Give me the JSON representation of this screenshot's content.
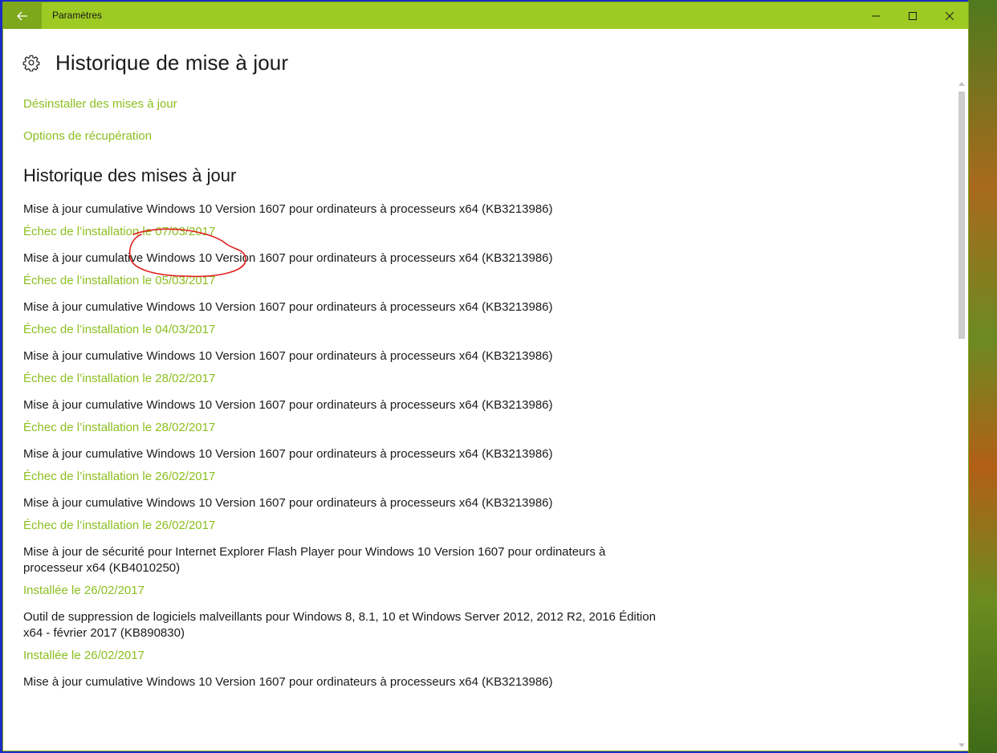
{
  "window": {
    "title": "Paramètres",
    "accent_color": "#9dcb23",
    "back_button_color": "#7ea81b",
    "link_color": "#8cbf20"
  },
  "header": {
    "icon": "gear-icon",
    "title": "Historique de mise à jour"
  },
  "links": {
    "uninstall": "Désinstaller des mises à jour",
    "recovery": "Options de récupération"
  },
  "history": {
    "section_title": "Historique des mises à jour",
    "items": [
      {
        "name": "Mise à jour cumulative Windows 10 Version 1607 pour ordinateurs à processeurs x64 (KB3213986)",
        "status": "Échec de l’installation le 07/03/2017"
      },
      {
        "name": "Mise à jour cumulative Windows 10 Version 1607 pour ordinateurs à processeurs x64 (KB3213986)",
        "status": "Échec de l’installation le 05/03/2017"
      },
      {
        "name": "Mise à jour cumulative Windows 10 Version 1607 pour ordinateurs à processeurs x64 (KB3213986)",
        "status": "Échec de l’installation le 04/03/2017"
      },
      {
        "name": "Mise à jour cumulative Windows 10 Version 1607 pour ordinateurs à processeurs x64 (KB3213986)",
        "status": "Échec de l’installation le 28/02/2017"
      },
      {
        "name": "Mise à jour cumulative Windows 10 Version 1607 pour ordinateurs à processeurs x64 (KB3213986)",
        "status": "Échec de l’installation le 28/02/2017"
      },
      {
        "name": "Mise à jour cumulative Windows 10 Version 1607 pour ordinateurs à processeurs x64 (KB3213986)",
        "status": "Échec de l’installation le 26/02/2017"
      },
      {
        "name": "Mise à jour cumulative Windows 10 Version 1607 pour ordinateurs à processeurs x64 (KB3213986)",
        "status": "Échec de l’installation le 26/02/2017"
      },
      {
        "name": "Mise à jour de sécurité pour Internet Explorer Flash Player pour Windows 10 Version 1607 pour ordinateurs à processeur x64 (KB4010250)",
        "status": "Installée le 26/02/2017"
      },
      {
        "name": "Outil de suppression de logiciels malveillants pour Windows 8, 8.1, 10 et Windows Server 2012, 2012 R2, 2016 Édition x64 - février 2017 (KB890830)",
        "status": "Installée le 26/02/2017"
      },
      {
        "name": "Mise à jour cumulative Windows 10 Version 1607 pour ordinateurs à processeurs x64 (KB3213986)",
        "status": ""
      }
    ]
  },
  "annotation": {
    "color": "#e0201e"
  }
}
